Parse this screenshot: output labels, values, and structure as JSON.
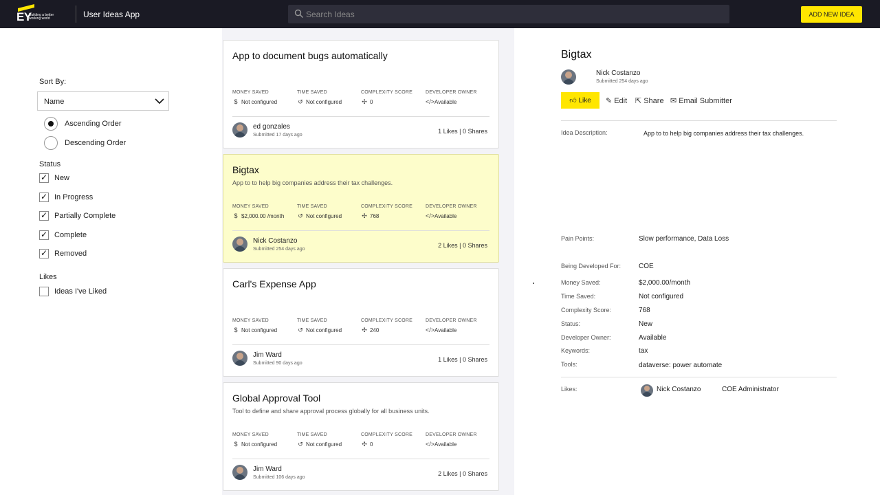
{
  "header": {
    "logo_text": "EY",
    "logo_tagline": "Building a better working world",
    "app_title": "User Ideas App",
    "search_placeholder": "Search Ideas",
    "add_button": "ADD NEW IDEA"
  },
  "sidebar": {
    "sort_label": "Sort By:",
    "sort_value": "Name",
    "order_options": [
      "Ascending Order",
      "Descending Order"
    ],
    "order_selected": "Ascending Order",
    "status_label": "Status",
    "status_items": [
      {
        "label": "New",
        "checked": true
      },
      {
        "label": "In Progress",
        "checked": true
      },
      {
        "label": "Partially Complete",
        "checked": true
      },
      {
        "label": "Complete",
        "checked": true
      },
      {
        "label": "Removed",
        "checked": true
      }
    ],
    "likes_label": "Likes",
    "likes_item": {
      "label": "Ideas I've Liked",
      "checked": false
    }
  },
  "metric_labels": {
    "money": "MONEY SAVED",
    "time": "TIME SAVED",
    "complexity": "COMPLEXITY SCORE",
    "owner": "DEVELOPER OWNER"
  },
  "cards": [
    {
      "title": "App to document bugs automatically",
      "description": "",
      "money": "Not configured",
      "time": "Not configured",
      "complexity": "0",
      "owner": "Available",
      "user": "ed gonzales",
      "submitted": "Submitted 17 days ago",
      "stats": "1 Likes | 0 Shares",
      "selected": false
    },
    {
      "title": "Bigtax",
      "description": "App to to help big companies address their tax challenges.",
      "money": "$2,000.00 /month",
      "time": "Not configured",
      "complexity": "768",
      "owner": "Available",
      "user": "Nick Costanzo",
      "submitted": "Submitted 254 days ago",
      "stats": "2 Likes | 0 Shares",
      "selected": true
    },
    {
      "title": "Carl's Expense App",
      "description": "",
      "money": "Not configured",
      "time": "Not configured",
      "complexity": "240",
      "owner": "Available",
      "user": "Jim Ward",
      "submitted": "Submitted 90 days ago",
      "stats": "1 Likes | 0 Shares",
      "selected": false
    },
    {
      "title": "Global Approval Tool",
      "description": "Tool to define and share approval process globally for all business units.",
      "money": "Not configured",
      "time": "Not configured",
      "complexity": "0",
      "owner": "Available",
      "user": "Jim Ward",
      "submitted": "Submitted 106 days ago",
      "stats": "2 Likes | 0 Shares",
      "selected": false
    }
  ],
  "detail": {
    "title": "Bigtax",
    "submitter": "Nick Costanzo",
    "submitted": "Submitted 254 days ago",
    "actions": {
      "like": "Like",
      "edit": "Edit",
      "share": "Share",
      "email": "Email Submitter"
    },
    "fields": {
      "description_label": "Idea Description:",
      "description": "App to to help big companies address their tax challenges.",
      "pain_label": "Pain Points:",
      "pain": "Slow performance, Data Loss",
      "dev_for_label": "Being Developed For:",
      "dev_for": "COE",
      "money_label": "Money Saved:",
      "money": "$2,000.00/month",
      "time_label": "Time Saved:",
      "time": "Not configured",
      "complexity_label": "Complexity Score:",
      "complexity": "768",
      "status_label": "Status:",
      "status": "New",
      "owner_label": "Developer Owner:",
      "owner": "Available",
      "keywords_label": "Keywords:",
      "keywords": "tax",
      "tools_label": "Tools:",
      "tools": "dataverse: power automate",
      "likes_label": "Likes:",
      "likes_user": "Nick Costanzo",
      "likes_role": "COE Administrator"
    }
  },
  "icons": {
    "money": "dollar-circle-icon",
    "time": "history-icon",
    "complexity": "puzzle-icon",
    "owner": "code-icon"
  },
  "colors": {
    "header_bg": "#1a1a24",
    "accent": "#ffe600",
    "selected_card": "#fdfdcb",
    "list_bg": "#f3f3f7"
  }
}
